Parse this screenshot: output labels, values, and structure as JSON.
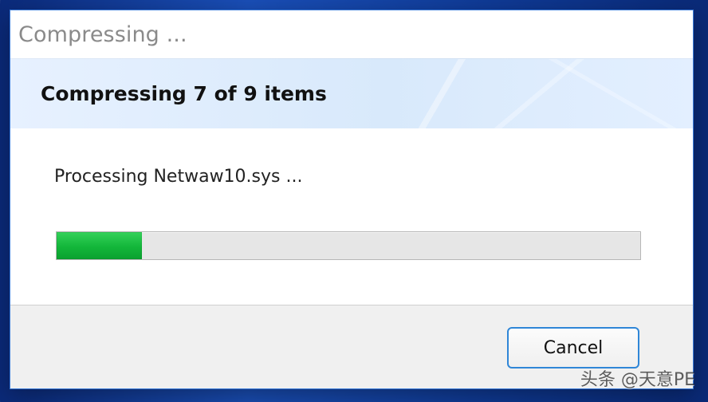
{
  "window": {
    "title": "Compressing ..."
  },
  "header": {
    "title": "Compressing 7 of 9 items"
  },
  "content": {
    "processing_text": "Processing Netwaw10.sys ..."
  },
  "progress": {
    "fraction": 0.146,
    "fill_color": "#13b63a"
  },
  "buttons": {
    "cancel_label": "Cancel"
  },
  "watermark": {
    "text": "头条 @天意PE"
  }
}
